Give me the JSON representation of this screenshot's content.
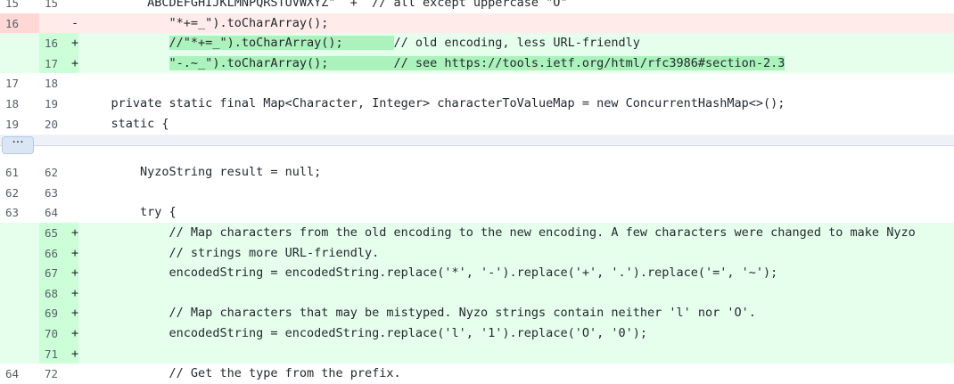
{
  "expand_button": {
    "label": "···"
  },
  "lines": [
    {
      "kind": "normal",
      "old": "15",
      "new": "15",
      "marker": "",
      "indent": "        ",
      "code": " ABCDEFGHIJKLMNPQRSTUVWXYZ\"  +  // all except uppercase \"O\""
    },
    {
      "kind": "del",
      "old": "16",
      "new": "",
      "marker": "-",
      "indent": "            ",
      "pre": "",
      "hl": "",
      "post": "\"*+=_\").toCharArray();"
    },
    {
      "kind": "add",
      "old": "",
      "new": "16",
      "marker": "+",
      "indent": "            ",
      "pre": "",
      "hl": "//\"*+=_\").toCharArray();       ",
      "post": "// old encoding, less URL-friendly"
    },
    {
      "kind": "add",
      "old": "",
      "new": "17",
      "marker": "+",
      "indent": "            ",
      "pre": "",
      "hl": "\"-.~_\").toCharArray();         // see https://tools.ietf.org/html/rfc3986#section-2.3",
      "post": ""
    },
    {
      "kind": "normal",
      "old": "17",
      "new": "18",
      "marker": "",
      "indent": "",
      "code": ""
    },
    {
      "kind": "normal",
      "old": "18",
      "new": "19",
      "marker": "",
      "indent": "    ",
      "code": "private static final Map<Character, Integer> characterToValueMap = new ConcurrentHashMap<>();"
    },
    {
      "kind": "normal",
      "old": "19",
      "new": "20",
      "marker": "",
      "indent": "    ",
      "code": "static {"
    },
    {
      "kind": "normal",
      "old": "61",
      "new": "62",
      "marker": "",
      "indent": "        ",
      "code": "NyzoString result = null;"
    },
    {
      "kind": "normal",
      "old": "62",
      "new": "63",
      "marker": "",
      "indent": "",
      "code": ""
    },
    {
      "kind": "normal",
      "old": "63",
      "new": "64",
      "marker": "",
      "indent": "        ",
      "code": "try {"
    },
    {
      "kind": "add",
      "old": "",
      "new": "65",
      "marker": "+",
      "indent": "            ",
      "code": "// Map characters from the old encoding to the new encoding. A few characters were changed to make Nyzo"
    },
    {
      "kind": "add",
      "old": "",
      "new": "66",
      "marker": "+",
      "indent": "            ",
      "code": "// strings more URL-friendly."
    },
    {
      "kind": "add",
      "old": "",
      "new": "67",
      "marker": "+",
      "indent": "            ",
      "code": "encodedString = encodedString.replace('*', '-').replace('+', '.').replace('=', '~');"
    },
    {
      "kind": "add",
      "old": "",
      "new": "68",
      "marker": "+",
      "indent": "",
      "code": ""
    },
    {
      "kind": "add",
      "old": "",
      "new": "69",
      "marker": "+",
      "indent": "            ",
      "code": "// Map characters that may be mistyped. Nyzo strings contain neither 'l' nor 'O'."
    },
    {
      "kind": "add",
      "old": "",
      "new": "70",
      "marker": "+",
      "indent": "            ",
      "code": "encodedString = encodedString.replace('l', '1').replace('O', '0');"
    },
    {
      "kind": "add",
      "old": "",
      "new": "71",
      "marker": "+",
      "indent": "",
      "code": ""
    },
    {
      "kind": "normal",
      "old": "64",
      "new": "72",
      "marker": "",
      "indent": "            ",
      "code": "// Get the type from the prefix."
    }
  ]
}
